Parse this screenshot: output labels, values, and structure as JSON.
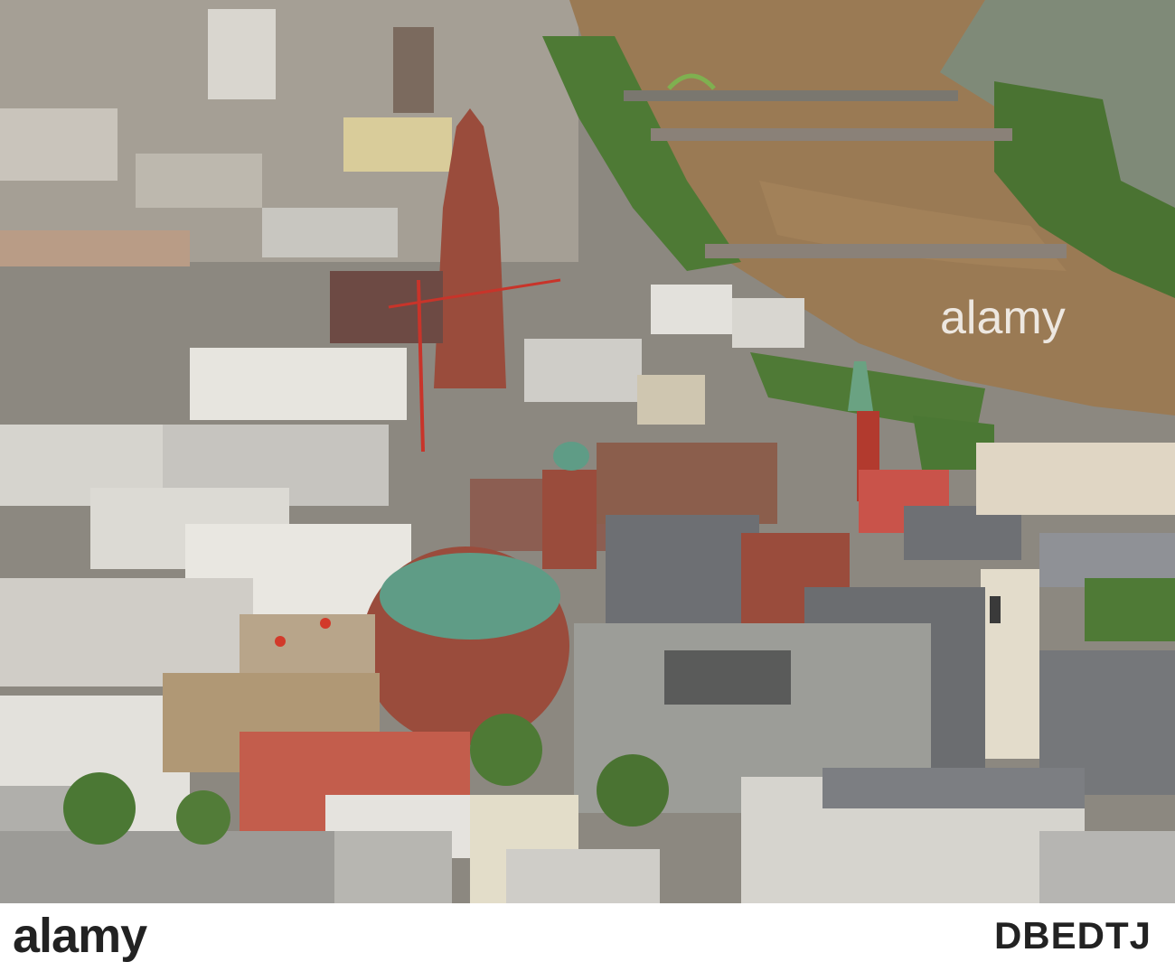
{
  "image": {
    "watermark": "alamy",
    "palette": {
      "river": "#9a7a54",
      "trees": "#4e7a35",
      "roofs": "#75777a",
      "sandstone": "#9a4c3c",
      "copper_dome": "#5f9c86",
      "white_facade": "#e7e5df"
    }
  },
  "footer": {
    "brand": "alamy",
    "image_code": "DBEDTJ"
  }
}
